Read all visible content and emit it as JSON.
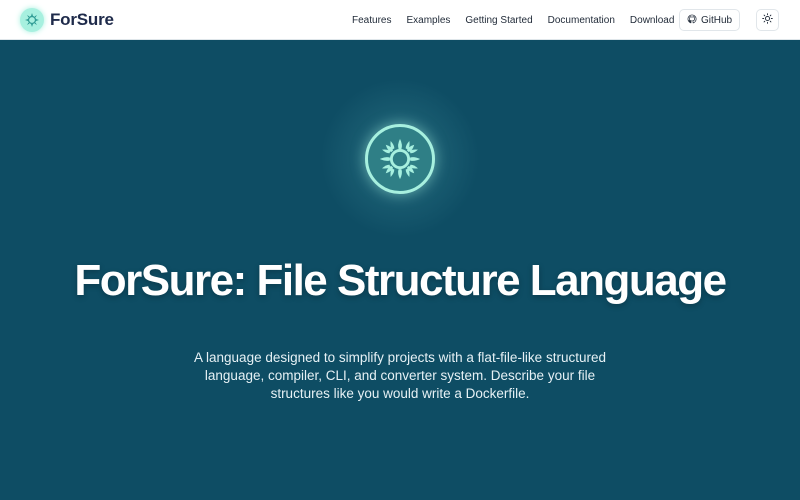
{
  "brand": {
    "name": "ForSure",
    "logo_icon": "sun-gear-icon"
  },
  "nav": {
    "links": [
      "Features",
      "Examples",
      "Getting Started",
      "Documentation",
      "Download"
    ],
    "github_label": "GitHub",
    "github_icon": "github-icon",
    "theme_toggle_icon": "sun-icon"
  },
  "hero": {
    "title": "ForSure: File Structure Language",
    "subtitle": "A language designed to simplify projects with a flat-file-like structured language, compiler, CLI, and converter system. Describe your file structures like you would write a Dockerfile.",
    "logo_icon": "sun-gear-icon"
  },
  "colors": {
    "hero_background": "#0e4d64",
    "accent": "#a7f0df",
    "navbar_background": "#ffffff",
    "brand_text": "#1e2a4a"
  }
}
